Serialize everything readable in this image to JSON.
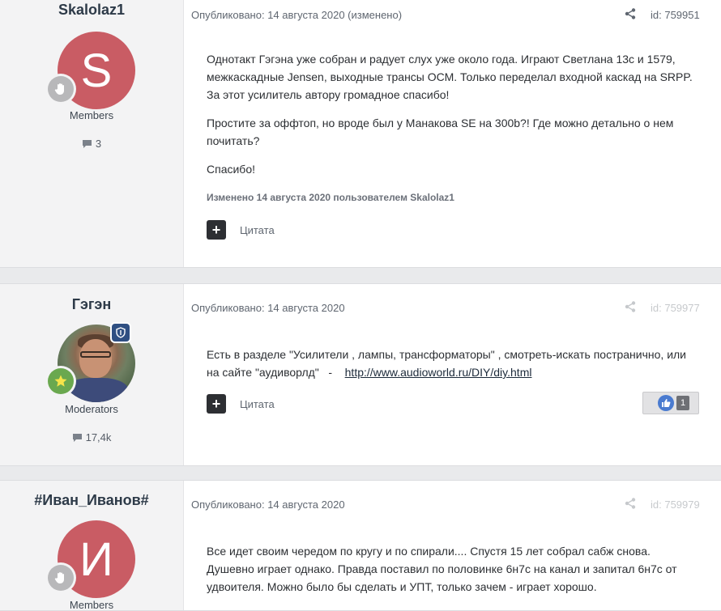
{
  "posts": [
    {
      "author": "Skalolaz1",
      "avatar_letter": "S",
      "avatar_color": "#c95c64",
      "group": "Members",
      "post_count": "3",
      "published": "Опубликовано: 14 августа 2020 (изменено)",
      "post_id": "id: 759951",
      "paragraphs": [
        "Однотакт Гэгэна уже собран и радует слух уже около года. Играют Светлана 13с и 1579, межкаскадные Jensen, выходные трансы ОСМ. Только переделал входной каскад на SRPP. За этот усилитель  автору громадное спасибо!",
        "Простите за оффтоп, но вроде был у Манакова SE на 300b?! Где можно детально о нем почитать?",
        "Спасибо!"
      ],
      "edited_note": "Изменено 14 августа 2020 пользователем Skalolaz1",
      "quote_label": "Цитата"
    },
    {
      "author": "Гэгэн",
      "group": "Moderators",
      "post_count": "17,4k",
      "published": "Опубликовано: 14 августа 2020",
      "post_id": "id: 759977",
      "text_before_link": "Есть в разделе \"Усилители , лампы, трансформаторы\" , смотреть-искать постранично, или на сайте \"аудиворлд\"   -    ",
      "link_text": "http://www.audioworld.ru/DIY/diy.html",
      "quote_label": "Цитата",
      "reaction_count": "1",
      "like_color": "#4a7bd0"
    },
    {
      "author": "#Иван_Иванов#",
      "avatar_letter": "И",
      "avatar_color": "#c95c64",
      "group": "Members",
      "published": "Опубликовано: 14 августа 2020",
      "post_id": "id: 759979",
      "paragraphs": [
        "Все идет своим чередом по кругу и по спирали.... Спустя 15 лет собрал сабж снова. Душевно играет однако. Правда поставил по половинке 6н7с на канал и запитал 6н7с от удвоителя. Можно было бы сделать и УПТ, только зачем - играет хорошо."
      ]
    }
  ],
  "icons": {
    "share": "share-icon",
    "comment": "comment-icon",
    "hand": "hand-icon",
    "star": "star-icon",
    "shield": "shield-icon",
    "plus": "plus-icon",
    "like": "thumbs-up-icon"
  }
}
